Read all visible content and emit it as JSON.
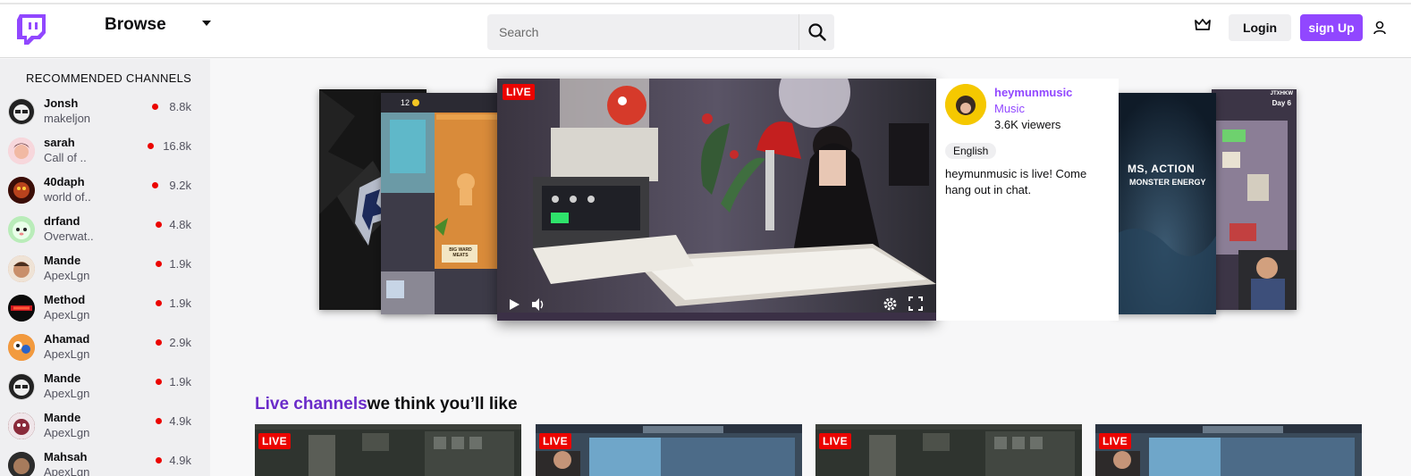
{
  "nav": {
    "browse_label": "Browse",
    "search_placeholder": "Search",
    "login_label": "Login",
    "signup_label": "sign Up",
    "brand_color": "#9147ff"
  },
  "sidebar": {
    "title": "RECOMMENDED CHANNELS",
    "channels": [
      {
        "name": "Jonsh",
        "game": "makeljon",
        "viewers": "8.8k"
      },
      {
        "name": "sarah",
        "game": "Call of ..",
        "viewers": "16.8k"
      },
      {
        "name": "40daph",
        "game": "world of..",
        "viewers": "9.2k"
      },
      {
        "name": "drfand",
        "game": "Overwat..",
        "viewers": "4.8k"
      },
      {
        "name": "Mande",
        "game": "ApexLgn",
        "viewers": "1.9k"
      },
      {
        "name": "Method",
        "game": "ApexLgn",
        "viewers": "1.9k"
      },
      {
        "name": "Ahamad",
        "game": "ApexLgn",
        "viewers": "2.9k"
      },
      {
        "name": "Mande",
        "game": "ApexLgn",
        "viewers": "1.9k"
      },
      {
        "name": "Mande",
        "game": "ApexLgn",
        "viewers": "4.9k"
      },
      {
        "name": "Mahsah",
        "game": "ApexLgn",
        "viewers": "4.9k"
      }
    ]
  },
  "carousel": {
    "live_label": "LIVE",
    "game_counter": "12",
    "sign_text": "BIG WARD MEATS",
    "right_card_text": "MS, ACTION",
    "right_card_subtext": "MONSTER ENERGY",
    "far_right_tag": "JTXHKW",
    "far_right_day": "Day 6",
    "featured": {
      "channel": "heymunmusic",
      "game": "Music",
      "viewers": "3.6K viewers",
      "language": "English",
      "description": "heymunmusic is live! Come hang out in chat."
    }
  },
  "live_section": {
    "title_accent": "Live channels",
    "title_rest": "we think you’ll like",
    "live_label": "LIVE"
  }
}
